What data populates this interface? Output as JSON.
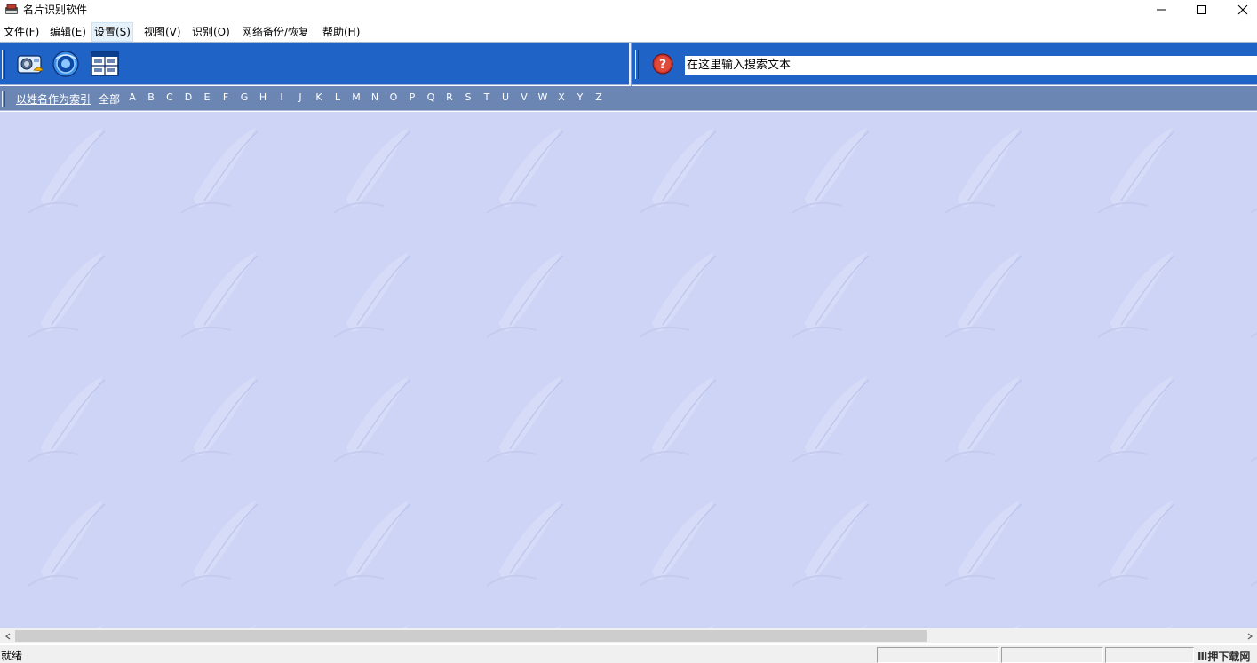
{
  "window": {
    "title": "名片识别软件",
    "controls": [
      "minimize-icon",
      "maximize-icon",
      "close-icon"
    ]
  },
  "menu": {
    "items": [
      {
        "label": "文件(F)"
      },
      {
        "label": "编辑(E)"
      },
      {
        "label": "设置(S)",
        "active": true
      },
      {
        "label": "视图(V)"
      },
      {
        "label": "识别(O)"
      },
      {
        "label": "网络备份/恢复"
      },
      {
        "label": "帮助(H)"
      }
    ]
  },
  "toolbar": {
    "buttons": [
      {
        "icon": "scan-card-icon"
      },
      {
        "icon": "camera-lens-icon"
      },
      {
        "icon": "card-layout-icon"
      }
    ],
    "help_icon": "help-icon",
    "search_value": "在这里输入搜索文本"
  },
  "index_bar": {
    "index_link": "以姓名作为索引",
    "all_label": "全部",
    "letters": [
      "A",
      "B",
      "C",
      "D",
      "E",
      "F",
      "G",
      "H",
      "I",
      "J",
      "K",
      "L",
      "M",
      "N",
      "O",
      "P",
      "Q",
      "R",
      "S",
      "T",
      "U",
      "V",
      "W",
      "X",
      "Y",
      "Z"
    ]
  },
  "statusbar": {
    "text": "就绪",
    "watermark": "Ⅲ押下载网"
  },
  "colors": {
    "toolbar_blue": "#1f63c7",
    "index_band": "#6b86b3",
    "content_bg": "#cdd4f6"
  }
}
